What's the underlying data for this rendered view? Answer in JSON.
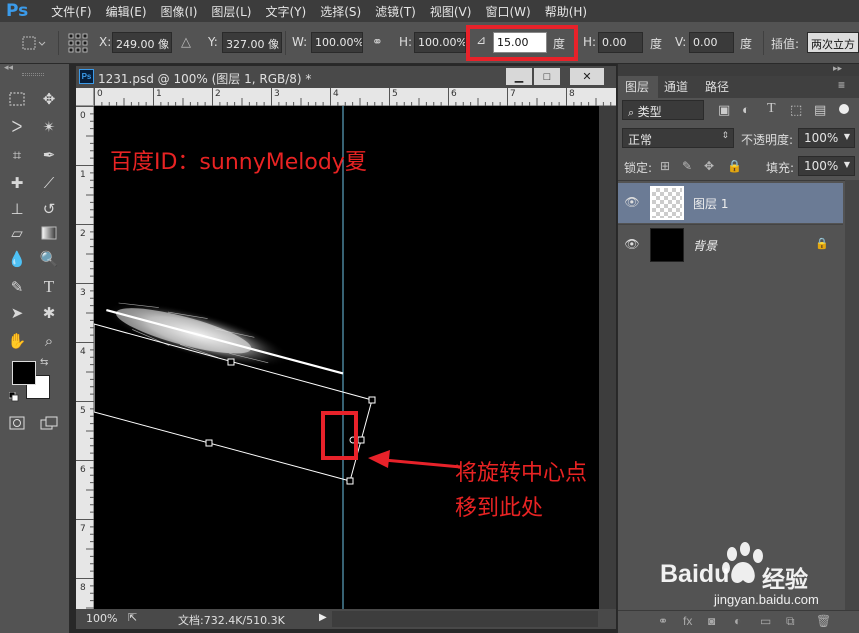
{
  "app": {
    "logo": "Ps",
    "menu": [
      "文件(F)",
      "编辑(E)",
      "图像(I)",
      "图层(L)",
      "文字(Y)",
      "选择(S)",
      "滤镜(T)",
      "视图(V)",
      "窗口(W)",
      "帮助(H)"
    ]
  },
  "options": {
    "x_label": "X:",
    "x_value": "249.00 像",
    "y_label": "Y:",
    "y_value": "327.00 像",
    "w_label": "W:",
    "w_value": "100.00%",
    "h_label": "H:",
    "h_value": "100.00%",
    "angle_value": "15.00",
    "angle_unit": "度",
    "hskew_label": "H:",
    "hskew_value": "0.00",
    "hskew_unit": "度",
    "vskew_label": "V:",
    "vskew_value": "0.00",
    "vskew_unit": "度",
    "interp_label": "插值:",
    "interp_value": "两次立方"
  },
  "document": {
    "title": "1231.psd @ 100% (图层 1, RGB/8) *",
    "ruler_top": [
      "0",
      "1",
      "2",
      "3",
      "4",
      "5",
      "6",
      "7",
      "8"
    ],
    "ruler_left": [
      "0",
      "1",
      "2",
      "3",
      "4",
      "5",
      "6",
      "7",
      "8"
    ],
    "zoom": "100%",
    "doc_info": "文档:732.4K/510.3K"
  },
  "annotations": {
    "watermark": "百度ID：sunnyMelody夏",
    "callout_line1": "将旋转中心点",
    "callout_line2": "移到此处",
    "highlight_color": "#e8222a"
  },
  "panel": {
    "tabs": [
      "图层",
      "通道",
      "路径"
    ],
    "filter_kind": "类型",
    "blend_mode": "正常",
    "opacity_label": "不透明度:",
    "opacity_value": "100%",
    "lock_label": "锁定:",
    "fill_label": "填充:",
    "fill_value": "100%",
    "layers": [
      {
        "name": "图层 1",
        "selected": true
      },
      {
        "name": "背景",
        "selected": false
      }
    ]
  },
  "baidu": {
    "brand": "Baidu",
    "brand_cn": "经验",
    "url": "jingyan.baidu.com"
  }
}
